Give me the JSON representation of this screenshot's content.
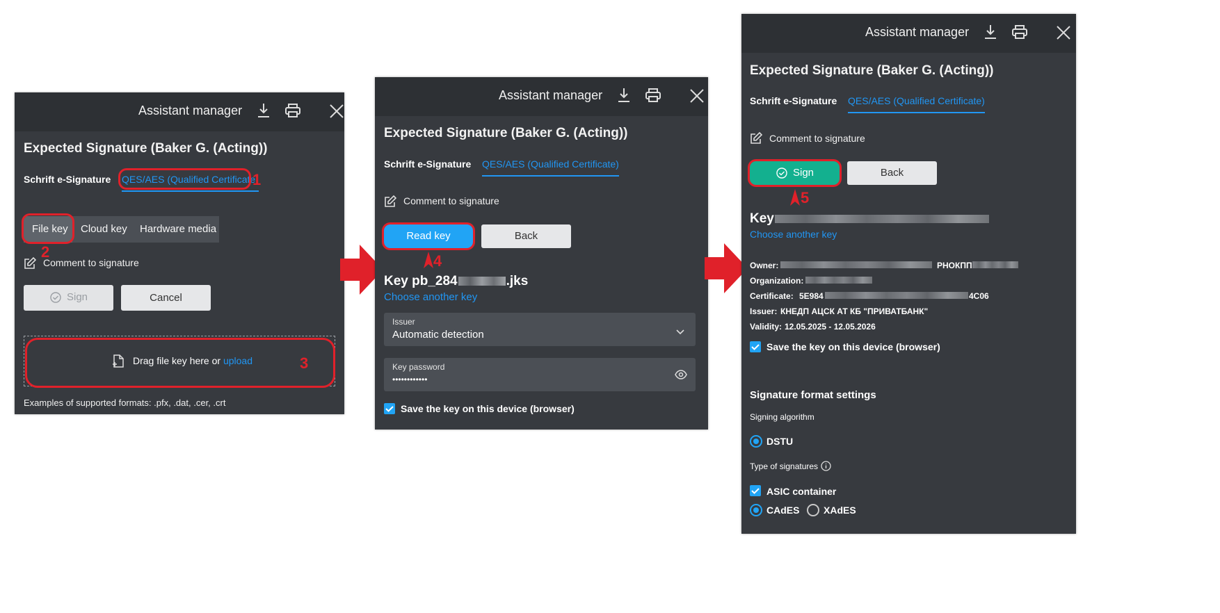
{
  "common": {
    "window_title": "Assistant manager",
    "page_title": "Expected Signature (Baker G. (Acting))",
    "tab_schrift": "Schrift e-Signature",
    "tab_qes": "QES/AES (Qualified Certificate)",
    "comment": "Comment to signature",
    "sign": "Sign",
    "back": "Back",
    "cancel": "Cancel",
    "choose_key": "Choose another key",
    "save_key": "Save the key on this device (browser)"
  },
  "panel1": {
    "key_types": [
      "File key",
      "Cloud key",
      "Hardware media"
    ],
    "drop_text": "Drag file key here or ",
    "drop_link": "upload",
    "formats": "Examples of supported formats: .pfx, .dat, .cer, .crt"
  },
  "panel2": {
    "read_key": "Read key",
    "key_prefix": "Key pb_284",
    "key_suffix": ".jks",
    "issuer_label": "Issuer",
    "issuer_value": "Automatic detection",
    "password_label": "Key password",
    "password_value": "••••••••••••"
  },
  "panel3": {
    "key_prefix": "Key",
    "owner_label": "Owner:",
    "owner_code": "РНОКПП",
    "org_label": "Organization:",
    "cert_label": "Certificate:",
    "cert_start": "5E984",
    "cert_end": "4C06",
    "issuer_label": "Issuer:",
    "issuer_value": "КНЕДП АЦСК АТ КБ \"ПРИВАТБАНК\"",
    "validity_label": "Validity:",
    "validity_value": "12.05.2025 - 12.05.2026",
    "format_title": "Signature format settings",
    "algo_label": "Signing algorithm",
    "algo_value": "DSTU",
    "type_label": "Type of signatures",
    "asic": "ASIC container",
    "cades": "CAdES",
    "xades": "XAdES"
  },
  "markers": [
    "1",
    "2",
    "3",
    "4",
    "5"
  ],
  "colors": {
    "accent": "#2196f3",
    "highlight": "#e0212a",
    "sign_green": "#13b08f",
    "panel": "#373a3f"
  }
}
